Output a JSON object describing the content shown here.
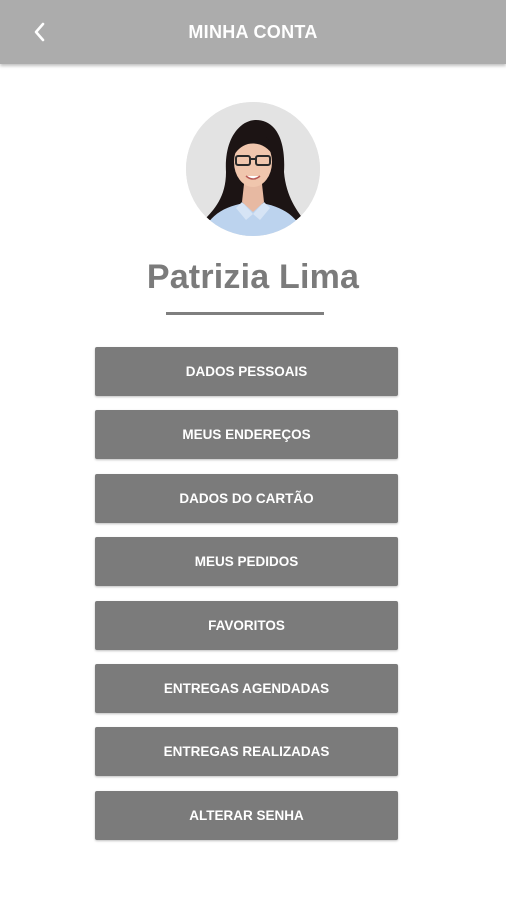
{
  "header": {
    "title": "MINHA CONTA",
    "back_icon": "chevron-left-icon"
  },
  "profile": {
    "name": "Patrizia Lima",
    "avatar": "user-avatar-photo"
  },
  "menu": {
    "items": [
      {
        "label": "DADOS PESSOAIS"
      },
      {
        "label": "MEUS ENDEREÇOS"
      },
      {
        "label": "DADOS DO CARTÃO"
      },
      {
        "label": "MEUS PEDIDOS"
      },
      {
        "label": "FAVORITOS"
      },
      {
        "label": "ENTREGAS AGENDADAS"
      },
      {
        "label": "ENTREGAS REALIZADAS"
      },
      {
        "label": "ALTERAR SENHA"
      }
    ]
  },
  "colors": {
    "header_bg": "#acacac",
    "button_bg": "#7b7b7b",
    "name_text": "#7b7b7b",
    "avatar_bg": "#e3e3e3"
  }
}
